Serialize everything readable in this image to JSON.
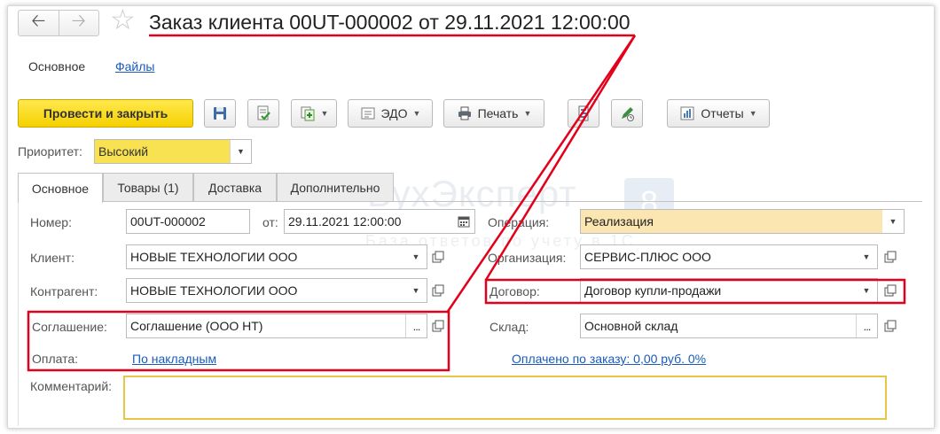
{
  "header": {
    "title": "Заказ клиента 00UT-000002 от 29.11.2021 12:00:00",
    "back_icon": "arrow-left-icon",
    "forward_icon": "arrow-right-icon",
    "favorite_icon": "star-icon"
  },
  "subnav": {
    "active": "Основное",
    "files": "Файлы"
  },
  "toolbar": {
    "post_and_close": "Провести и закрыть",
    "edo": "ЭДО",
    "print": "Печать",
    "reports": "Отчеты"
  },
  "priority": {
    "label": "Приоритет:",
    "value": "Высокий"
  },
  "tabs": [
    {
      "label": "Основное"
    },
    {
      "label": "Товары (1)"
    },
    {
      "label": "Доставка"
    },
    {
      "label": "Дополнительно"
    }
  ],
  "form": {
    "number": {
      "label": "Номер:",
      "value": "00UT-000002"
    },
    "date": {
      "label": "от:",
      "value": "29.11.2021 12:00:00"
    },
    "operation": {
      "label": "Операция:",
      "value": "Реализация"
    },
    "client": {
      "label": "Клиент:",
      "value": "НОВЫЕ ТЕХНОЛОГИИ ООО"
    },
    "organization": {
      "label": "Организация:",
      "value": "СЕРВИС-ПЛЮС ООО"
    },
    "counterparty": {
      "label": "Контрагент:",
      "value": "НОВЫЕ ТЕХНОЛОГИИ ООО"
    },
    "contract": {
      "label": "Договор:",
      "value": "Договор купли-продажи"
    },
    "agreement": {
      "label": "Соглашение:",
      "value": "Соглашение (ООО НТ)",
      "more": "..."
    },
    "warehouse": {
      "label": "Склад:",
      "value": "Основной склад",
      "more": "..."
    },
    "payment": {
      "label": "Оплата:",
      "value": "По накладным"
    },
    "paid": {
      "value": "Оплачено по заказу: 0,00 руб. 0%"
    },
    "comment": {
      "label": "Комментарий:",
      "value": ""
    }
  },
  "watermark": {
    "brand": "БухЭксперт",
    "logo": "8",
    "tagline": "База ответов по учету в 1С"
  },
  "colors": {
    "accent_yellow": "#f5d000",
    "annotation_red": "#e3001b",
    "link_blue": "#1a5bb8",
    "tinted_field": "#fbe6b2"
  }
}
